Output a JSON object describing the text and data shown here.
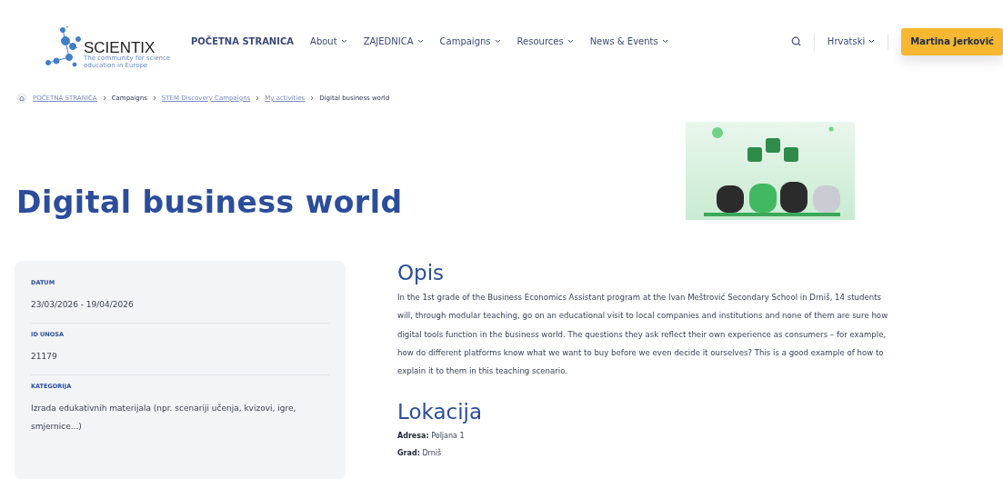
{
  "logo": {
    "name": "SCIENTIX",
    "tagline": "The community for science education in Europe"
  },
  "nav": [
    {
      "label": "POČETNA STRANICA",
      "dropdown": false
    },
    {
      "label": "About",
      "dropdown": true
    },
    {
      "label": "ZAJEDNICA",
      "dropdown": true
    },
    {
      "label": "Campaigns",
      "dropdown": true
    },
    {
      "label": "Resources",
      "dropdown": true
    },
    {
      "label": "News & Events",
      "dropdown": true
    }
  ],
  "language": "Hrvatski",
  "user_button": "Martina Jerković",
  "breadcrumb": [
    {
      "label": "POČETNA STRANICA",
      "kind": "link"
    },
    {
      "label": "Campaigns",
      "kind": "text"
    },
    {
      "label": "STEM Discovery Campaigns",
      "kind": "link"
    },
    {
      "label": "My activities",
      "kind": "link"
    },
    {
      "label": "Digital business world",
      "kind": "current"
    }
  ],
  "title": "Digital business world",
  "details": [
    {
      "label": "DATUM",
      "value": "23/03/2026 - 19/04/2026"
    },
    {
      "label": "ID UNOSA",
      "value": "21179"
    },
    {
      "label": "KATEGORIJA",
      "value": "Izrada edukativnih materijala (npr. scenariji učenja, kvizovi, igre, smjernice...)"
    }
  ],
  "description": {
    "heading": "Opis",
    "text": "In the 1st grade of the Business Economics Assistant program at the Ivan Meštrović Secondary School in Drniš, 14 students will, through modular teaching, go on an educational visit to local companies and institutions and none of them are sure how digital tools function in the business world. The questions they ask reflect their own experience as consumers – for example, how do different platforms know what we want to buy before we even decide it ourselves? This is a good example of how to explain it to them in this teaching scenario."
  },
  "location": {
    "heading": "Lokacija",
    "fields": [
      "**Adresa:** Poljana 1",
      "**Grad:** Drniš"
    ]
  }
}
